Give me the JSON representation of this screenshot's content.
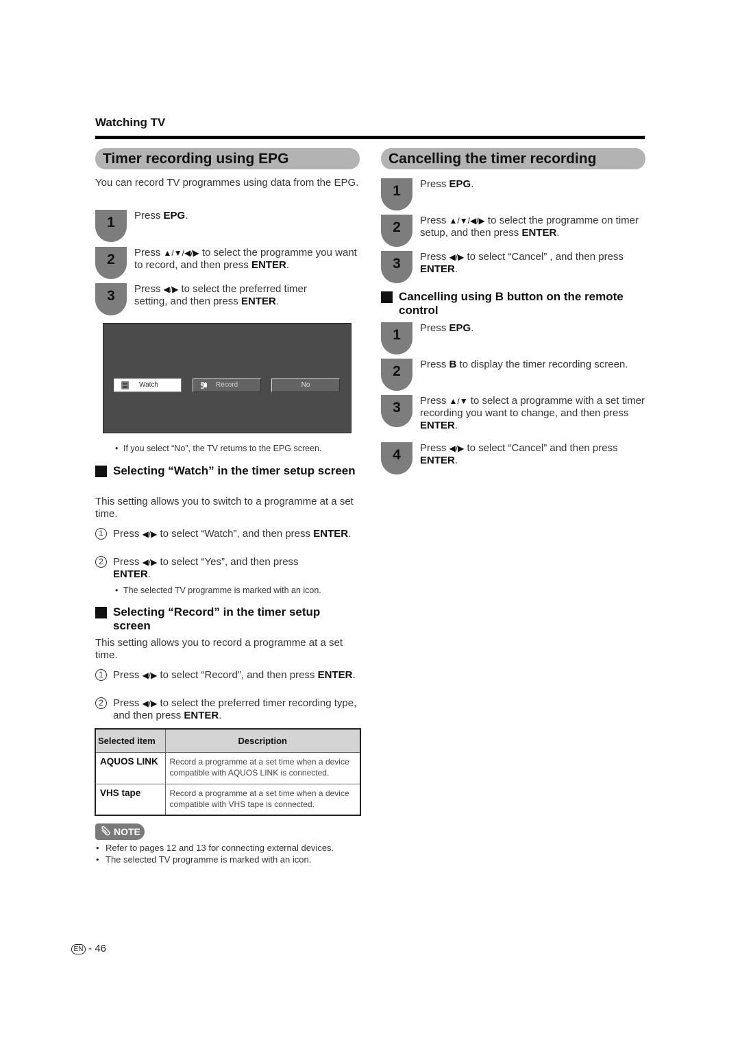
{
  "page": {
    "section": "Watching TV",
    "page_prefix": "EN",
    "page_sep": "-",
    "page_number": "46"
  },
  "left": {
    "title": "Timer recording using EPG",
    "intro": "You can record TV programmes using data from the EPG.",
    "steps": [
      {
        "num": "1",
        "pre": "Press ",
        "bold": "EPG",
        "post": "."
      },
      {
        "num": "2",
        "pre": "Press ",
        "arrows": "▲/▼/◀/▶",
        "mid": " to select the programme you want to record, and then press ",
        "bold": "ENTER",
        "post": "."
      },
      {
        "num": "3",
        "pre": "Press ",
        "arrows": "◀/▶",
        "mid": " to select the preferred timer setting, and then press ",
        "bold": "ENTER",
        "post": "."
      }
    ],
    "tv_screen": {
      "buttons": [
        {
          "label": "Watch",
          "icon": "watch-icon",
          "selected": true
        },
        {
          "label": "Record",
          "icon": "record-icon",
          "selected": false
        },
        {
          "label": "No",
          "icon": "",
          "selected": false
        }
      ]
    },
    "screen_note": "If you select “No”, the TV returns to the EPG screen.",
    "watch_section": {
      "heading": "Selecting “Watch” in the timer setup screen",
      "intro": "This setting allows you to switch to a programme at a set time.",
      "steps": [
        {
          "num": "1",
          "pre": "Press ",
          "arrows": "◀/▶",
          "mid": " to select “Watch”, and then press ",
          "bold": "ENTER",
          "post": "."
        },
        {
          "num": "2",
          "pre": "Press ",
          "arrows": "◀/▶",
          "mid": " to select “Yes”, and then press ",
          "bold": "ENTER",
          "post": "."
        }
      ],
      "note": "The selected TV programme is marked with an icon."
    },
    "record_section": {
      "heading": "Selecting “Record” in the timer setup screen",
      "intro": "This setting allows you to record a programme at a set time.",
      "steps": [
        {
          "num": "1",
          "pre": "Press ",
          "arrows": "◀/▶",
          "mid": " to select “Record”, and then press ",
          "bold": "ENTER",
          "post": "."
        },
        {
          "num": "2",
          "pre": "Press ",
          "arrows": "◀/▶",
          "mid": " to select the preferred timer recording type, and then press ",
          "bold": "ENTER",
          "post": "."
        }
      ]
    },
    "table": {
      "headers": [
        "Selected item",
        "Description"
      ],
      "rows": [
        {
          "item": "AQUOS LINK",
          "desc": "Record a programme at a set time when a device compatible with AQUOS LINK is connected."
        },
        {
          "item": "VHS tape",
          "desc": "Record a programme at a set time when a device compatible with VHS tape is connected."
        }
      ]
    },
    "note": {
      "label": "NOTE",
      "items": [
        "Refer to pages 12 and 13 for connecting external devices.",
        "The selected TV programme is marked with an icon."
      ]
    }
  },
  "right": {
    "title": "Cancelling the timer recording",
    "steps": [
      {
        "num": "1",
        "pre": "Press ",
        "bold": "EPG",
        "post": "."
      },
      {
        "num": "2",
        "pre": "Press ",
        "arrows": "▲/▼/◀/▶",
        "mid": " to select the programme on timer setup, and then press ",
        "bold": "ENTER",
        "post": "."
      },
      {
        "num": "3",
        "pre": "Press ",
        "arrows": "◀/▶",
        "mid": " to select “Cancel” , and then press ",
        "bold": "ENTER",
        "post": "."
      }
    ],
    "b_section": {
      "heading": "Cancelling using B button on the remote control",
      "steps": [
        {
          "num": "1",
          "pre": "Press ",
          "bold": "EPG",
          "post": "."
        },
        {
          "num": "2",
          "pre": "Press ",
          "bold": "B",
          "post": " to display the timer recording screen."
        },
        {
          "num": "3",
          "pre": "Press ",
          "arrows": "▲/▼",
          "mid": " to select a programme with a set timer recording you want to change, and then press ",
          "bold": "ENTER",
          "post": "."
        },
        {
          "num": "4",
          "pre": "Press ",
          "arrows": "◀/▶",
          "mid": " to select “Cancel” and then press ",
          "bold": "ENTER",
          "post": "."
        }
      ]
    }
  }
}
